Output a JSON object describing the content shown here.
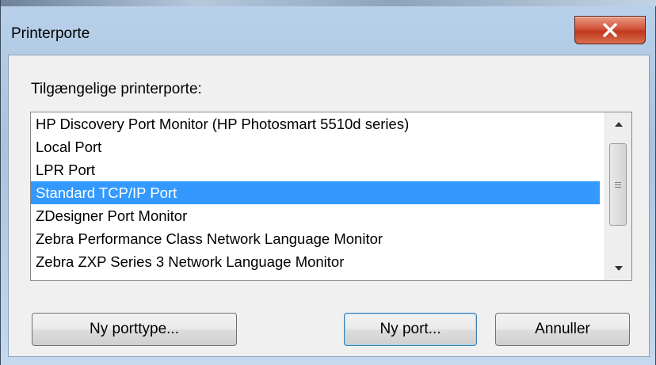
{
  "window": {
    "title": "Printerporte",
    "close_glyph": "X"
  },
  "list": {
    "label": "Tilgængelige printerporte:",
    "items": [
      "HP Discovery Port Monitor (HP Photosmart 5510d series)",
      "Local Port",
      "LPR Port",
      "Standard TCP/IP Port",
      "ZDesigner Port Monitor",
      "Zebra Performance Class Network Language Monitor",
      "Zebra ZXP Series 3 Network Language Monitor"
    ],
    "selected_index": 3
  },
  "buttons": {
    "new_port_type": "Ny porttype...",
    "new_port": "Ny port...",
    "cancel": "Annuller"
  },
  "colors": {
    "selection": "#3399ff",
    "close_button": "#c7432a"
  }
}
